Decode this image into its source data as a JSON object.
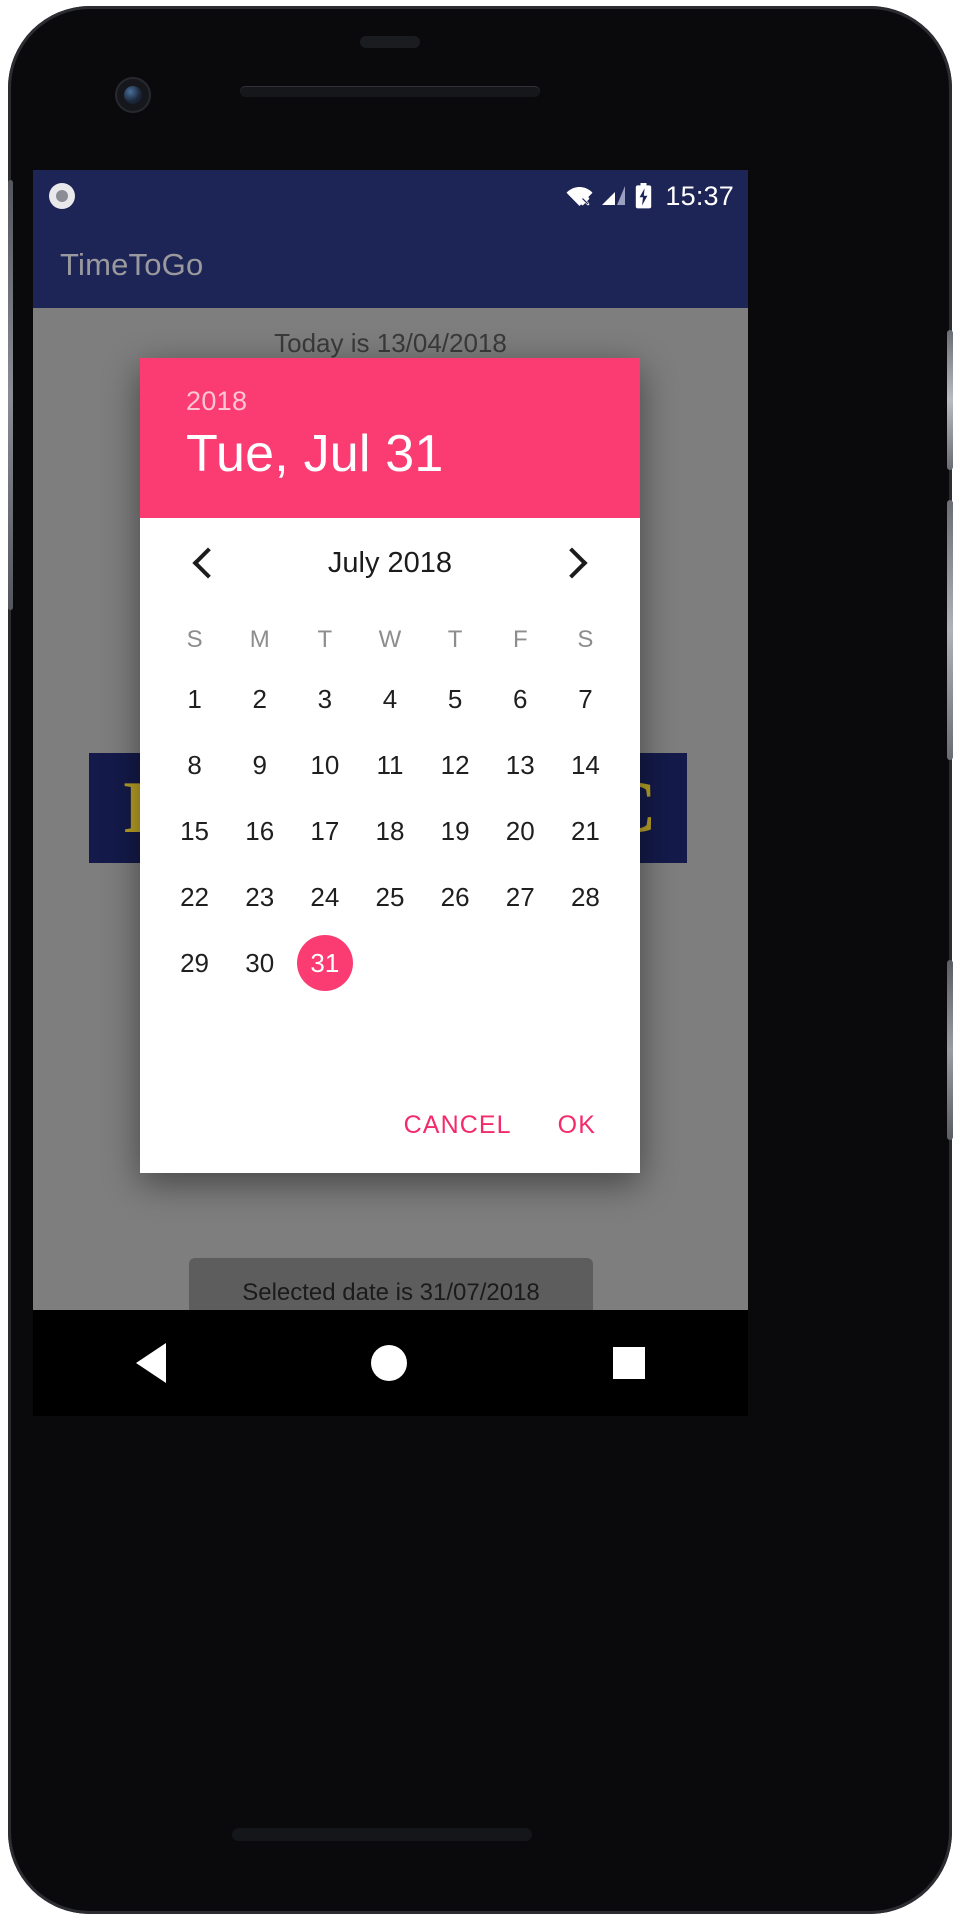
{
  "device": {
    "type": "android-phone-mockup",
    "bezel_color": "#0a0a0c"
  },
  "status_bar": {
    "background": "#1d2456",
    "time": "15:37",
    "icons": [
      "record-dot-icon",
      "wifi-off-icon",
      "cellular-signal-icon",
      "battery-charging-icon"
    ]
  },
  "app_bar": {
    "title": "TimeToGo",
    "background": "#1d2456",
    "title_color": "#9a9a9e"
  },
  "app_content": {
    "today_text": "Today is 13/04/2018",
    "logo_left_text": "F",
    "logo_right_text": "C",
    "toast_text": "Selected date is 31/07/2018"
  },
  "dialog": {
    "accent_color": "#FA3C72",
    "header": {
      "year": "2018",
      "selected_date": "Tue, Jul 31"
    },
    "nav": {
      "prev_label": "chevron-left-icon",
      "next_label": "chevron-right-icon",
      "month_label": "July 2018"
    },
    "weekdays": [
      "S",
      "M",
      "T",
      "W",
      "T",
      "F",
      "S"
    ],
    "leading_blanks": 0,
    "days": [
      1,
      2,
      3,
      4,
      5,
      6,
      7,
      8,
      9,
      10,
      11,
      12,
      13,
      14,
      15,
      16,
      17,
      18,
      19,
      20,
      21,
      22,
      23,
      24,
      25,
      26,
      27,
      28,
      29,
      30,
      31
    ],
    "selected_day": 31,
    "actions": {
      "cancel_label": "CANCEL",
      "ok_label": "OK"
    }
  },
  "nav_bar": {
    "back_label": "back-button",
    "home_label": "home-button",
    "recents_label": "recents-button"
  }
}
